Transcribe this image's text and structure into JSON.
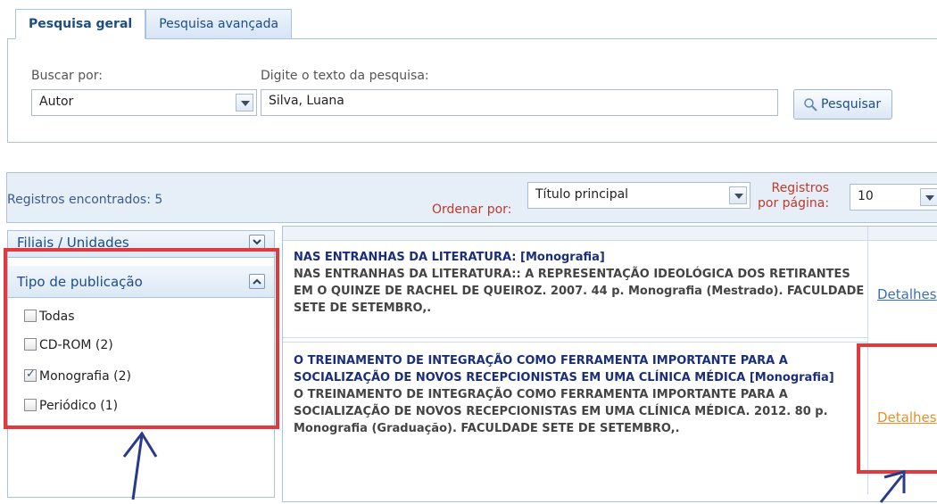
{
  "tabs": [
    {
      "label": "Pesquisa geral",
      "active": true
    },
    {
      "label": "Pesquisa avançada",
      "active": false
    }
  ],
  "search": {
    "search_by_label": "Buscar por:",
    "search_by_value": "Autor",
    "text_label": "Digite o texto da pesquisa:",
    "text_value": "Silva, Luana",
    "button_label": "Pesquisar"
  },
  "results_bar": {
    "count_label": "Registros encontrados:",
    "count_value": "5",
    "order_label": "Ordenar por:",
    "order_value": "Título principal",
    "per_page_label_1": "Registros",
    "per_page_label_2": "por página:",
    "per_page_value": "10"
  },
  "sidebar": {
    "branches_title": "Filiais / Unidades",
    "pub_type_title": "Tipo de publicação",
    "filters": [
      {
        "label": "Todas",
        "checked": false
      },
      {
        "label": "CD-ROM (2)",
        "checked": false
      },
      {
        "label": "Monografia (2)",
        "checked": true
      },
      {
        "label": "Periódico (1)",
        "checked": false
      }
    ]
  },
  "records": [
    {
      "title": "NAS ENTRANHAS DA LITERATURA: [Monografia]",
      "body": "NAS ENTRANHAS DA LITERATURA:: A REPRESENTAÇÃO IDEOLÓGICA DOS RETIRANTES EM O QUINZE DE RACHEL DE QUEIROZ. 2007. 44 p. Monografia (Mestrado). FACULDADE SETE DE SETEMBRO,.",
      "details_label": "Detalhes"
    },
    {
      "title": "O TREINAMENTO DE INTEGRAÇÃO COMO FERRAMENTA IMPORTANTE PARA A SOCIALIZAÇÃO DE NOVOS RECEPCIONISTAS EM UMA CLÍNICA MÉDICA [Monografia]",
      "body": "O TREINAMENTO DE INTEGRAÇÃO COMO FERRAMENTA IMPORTANTE PARA A SOCIALIZAÇÃO DE NOVOS RECEPCIONISTAS EM UMA CLÍNICA MÉDICA. 2012. 80 p. Monografia (Graduação). FACULDADE SETE DE SETEMBRO,.",
      "details_label": "Detalhes"
    }
  ],
  "colors": {
    "accent_blue": "#1c4d87",
    "highlight_red": "#e03a3e",
    "link_blue": "#3a6fb5",
    "link_orange": "#e8912c"
  }
}
